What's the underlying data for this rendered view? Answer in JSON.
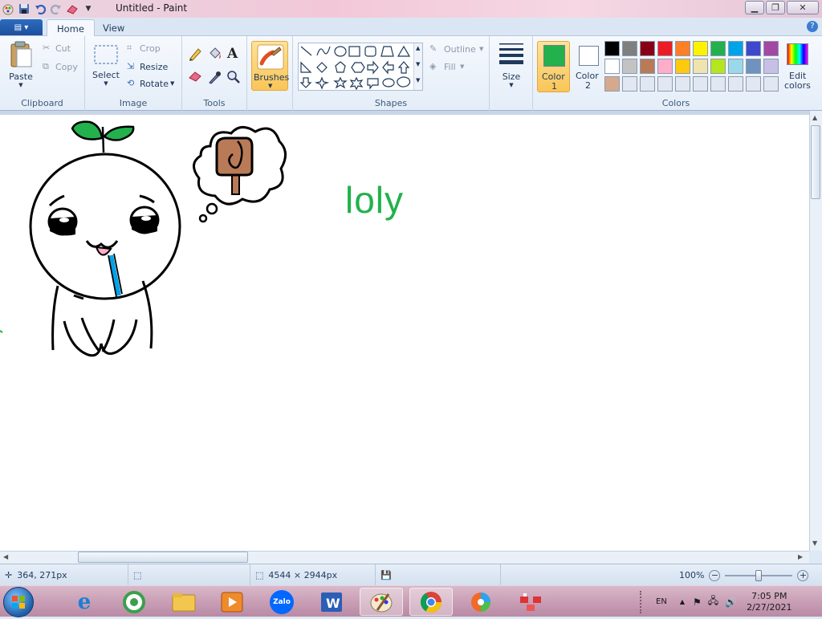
{
  "window": {
    "title": "Untitled - Paint"
  },
  "tabs": {
    "home": "Home",
    "view": "View"
  },
  "clipboard": {
    "paste": "Paste",
    "cut": "Cut",
    "copy": "Copy",
    "label": "Clipboard"
  },
  "image": {
    "select": "Select",
    "crop": "Crop",
    "resize": "Resize",
    "rotate": "Rotate",
    "label": "Image"
  },
  "tools": {
    "label": "Tools"
  },
  "brushes": {
    "label": "Brushes"
  },
  "shapes": {
    "outline": "Outline",
    "fill": "Fill",
    "label": "Shapes"
  },
  "size": {
    "label": "Size"
  },
  "colors": {
    "color1": "Color",
    "color1_num": "1",
    "color2": "Color",
    "color2_num": "2",
    "edit1": "Edit",
    "edit2": "colors",
    "label": "Colors",
    "color1_value": "#22b14c",
    "color2_value": "#ffffff",
    "palette_row1": [
      "#000000",
      "#7f7f7f",
      "#880015",
      "#ed1c24",
      "#ff7f27",
      "#fff200",
      "#22b14c",
      "#00a2e8",
      "#3f48cc",
      "#a349a4"
    ],
    "palette_row2": [
      "#ffffff",
      "#c3c3c3",
      "#b97a57",
      "#ffaec9",
      "#ffc90e",
      "#efe4b0",
      "#b5e61d",
      "#99d9ea",
      "#7092be",
      "#c8bfe7"
    ],
    "palette_row3": [
      "#d7a98c",
      "#e1e8f2",
      "#e1e8f2",
      "#e1e8f2",
      "#e1e8f2",
      "#e1e8f2",
      "#e1e8f2",
      "#e1e8f2",
      "#e1e8f2",
      "#e1e8f2"
    ]
  },
  "canvas": {
    "text": "loly"
  },
  "status": {
    "cursor": "364, 271px",
    "dimensions": "4544 × 2944px",
    "zoom": "100%"
  },
  "taskbar": {
    "lang": "EN",
    "time": "7:05 PM",
    "date": "2/27/2021",
    "zalo": "Zalo"
  }
}
